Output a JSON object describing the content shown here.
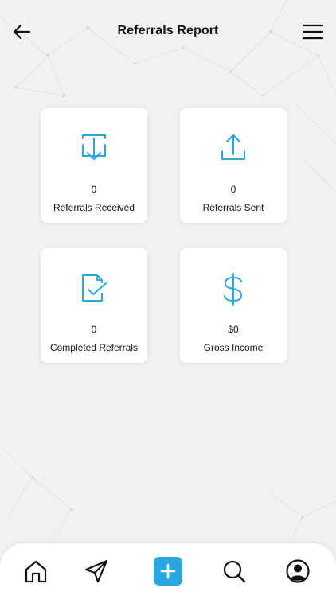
{
  "header": {
    "title": "Referrals Report",
    "back_icon": "arrow-left-icon",
    "menu_icon": "hamburger-menu-icon"
  },
  "cards": [
    {
      "icon": "download-tray-icon",
      "value": "0",
      "label": "Referrals Received"
    },
    {
      "icon": "upload-tray-icon",
      "value": "0",
      "label": "Referrals Sent"
    },
    {
      "icon": "document-check-icon",
      "value": "0",
      "label": "Completed Referrals"
    },
    {
      "icon": "dollar-icon",
      "value": "$0",
      "label": "Gross Income"
    }
  ],
  "bottom_nav": {
    "items": [
      "home-icon",
      "send-icon",
      "plus-icon",
      "search-icon",
      "profile-icon"
    ]
  },
  "colors": {
    "accent": "#29a7e1",
    "background": "#f1f1f2",
    "card": "#ffffff",
    "text": "#111111"
  }
}
